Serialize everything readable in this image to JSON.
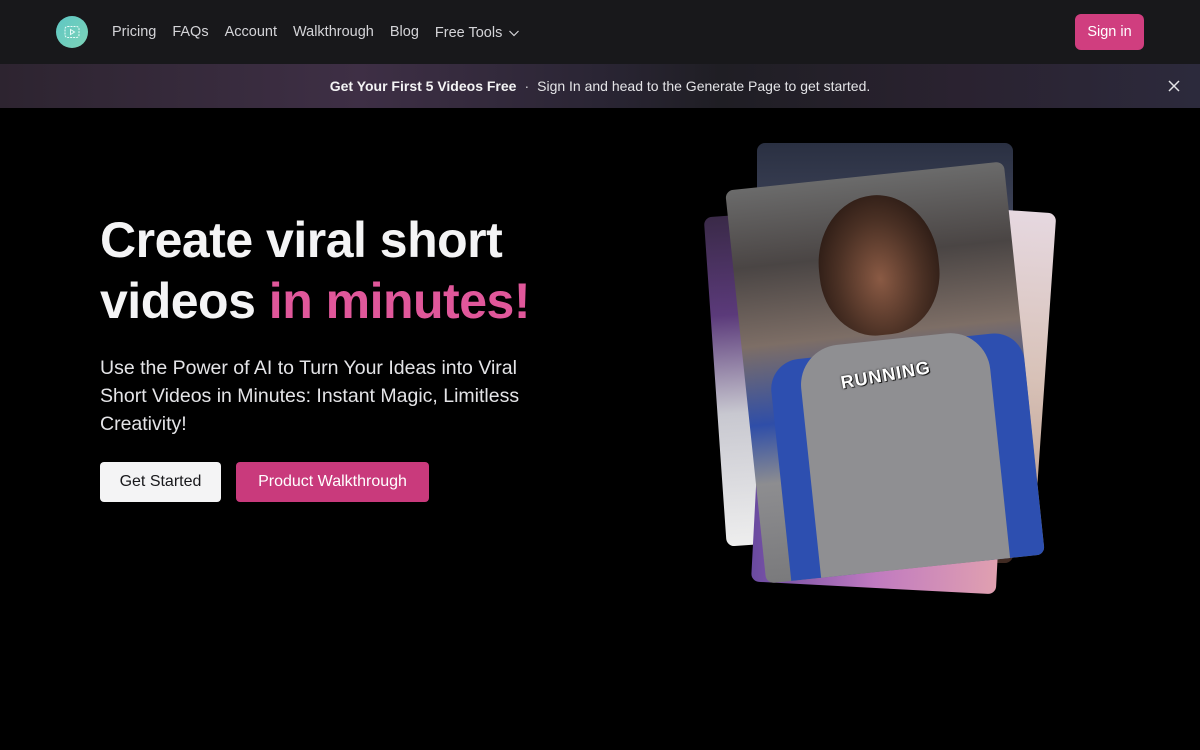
{
  "nav": {
    "logo_icon": "play-video-icon",
    "links": [
      "Pricing",
      "FAQs",
      "Account",
      "Walkthrough",
      "Blog"
    ],
    "dropdown_label": "Free Tools",
    "dropdown_icon": "chevron-down-icon",
    "signin_label": "Sign in"
  },
  "banner": {
    "bold": "Get Your First 5 Videos Free",
    "separator": "·",
    "text": "Sign In and head to the Generate Page to get started.",
    "close_icon": "close-icon"
  },
  "hero": {
    "title_line1": "Create viral short",
    "title_line2_plain": "videos ",
    "title_line2_accent": "in minutes!",
    "subtitle": "Use the Power of AI to Turn Your Ideas into Viral Short Videos in Minutes: Instant Magic, Limitless Creativity!",
    "primary_button": "Get Started",
    "secondary_button": "Product Walkthrough",
    "preview_caption": "RUNNING"
  },
  "colors": {
    "accent": "#d03e7f",
    "nav_bg": "#18181b",
    "logo": "#5ec7c4"
  }
}
